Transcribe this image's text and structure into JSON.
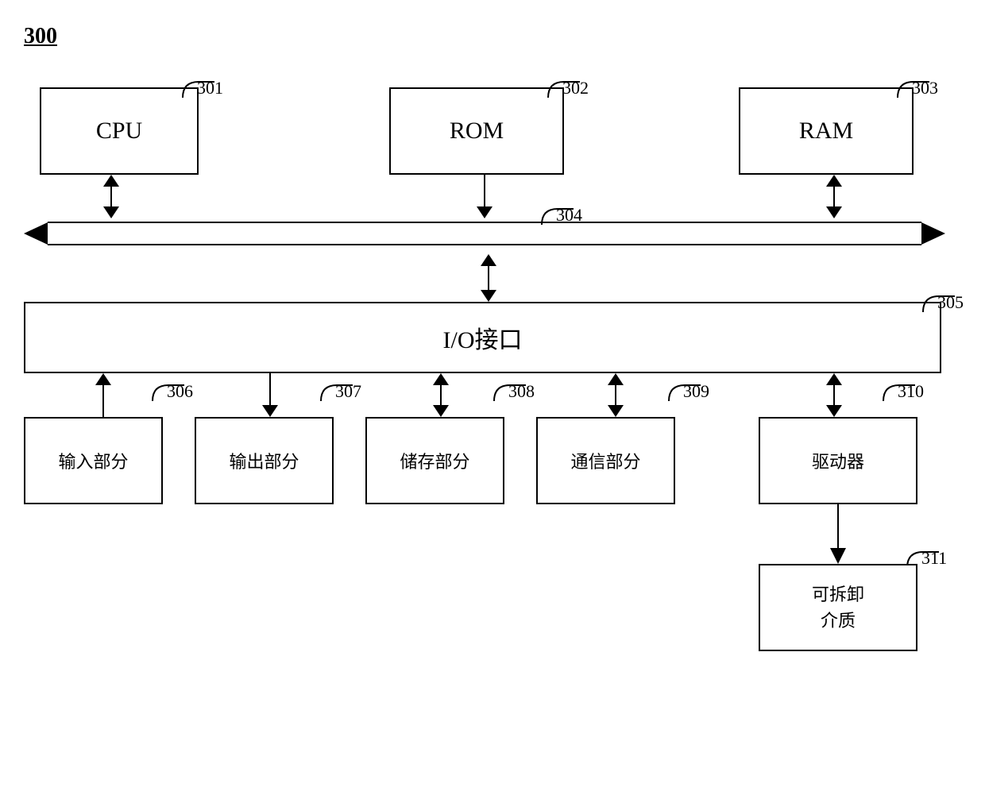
{
  "figure": {
    "label": "300",
    "components": {
      "cpu": {
        "id": "301",
        "label": "CPU"
      },
      "rom": {
        "id": "302",
        "label": "ROM"
      },
      "ram": {
        "id": "303",
        "label": "RAM"
      },
      "bus": {
        "id": "304"
      },
      "io": {
        "id": "305",
        "label": "I/O接口"
      },
      "input": {
        "id": "306",
        "label": "输入部分"
      },
      "output": {
        "id": "307",
        "label": "输出部分"
      },
      "storage": {
        "id": "308",
        "label": "储存部分"
      },
      "comm": {
        "id": "309",
        "label": "通信部分"
      },
      "driver": {
        "id": "310",
        "label": "驱动器"
      },
      "removable": {
        "id": "311",
        "label": "可拆卸\n介质"
      }
    }
  }
}
